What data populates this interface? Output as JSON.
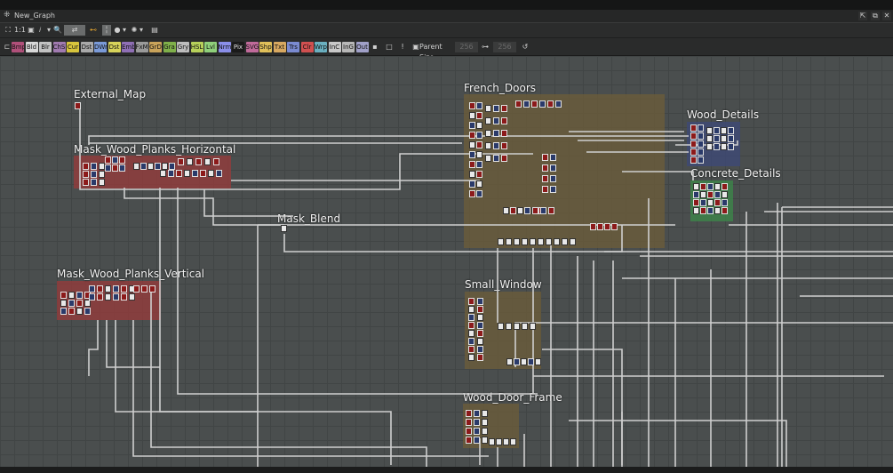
{
  "window": {
    "title": "New_Graph"
  },
  "toolbar": {
    "fit_label": "1:1",
    "buttons": [
      "fit-view-icon",
      "actual-size",
      "image-icon",
      "info-icon",
      "zoom-icon",
      "link-tool-icon",
      "snap-icon",
      "bulb-icon",
      "gear-icon",
      "screenshot-icon"
    ]
  },
  "filters": {
    "chips": [
      {
        "label": "Bmp",
        "color": "#b0507a"
      },
      {
        "label": "Bld",
        "color": "#d8d8d8"
      },
      {
        "label": "Blr",
        "color": "#c2c2c2"
      },
      {
        "label": "ChS",
        "color": "#a07ab0"
      },
      {
        "label": "Cur",
        "color": "#d7c43c"
      },
      {
        "label": "Dst",
        "color": "#a9a9a9"
      },
      {
        "label": "DWr",
        "color": "#7a9ad8"
      },
      {
        "label": "Dst",
        "color": "#d7d35a"
      },
      {
        "label": "Emb",
        "color": "#8f6fb5"
      },
      {
        "label": "FxM",
        "color": "#9a9a9a"
      },
      {
        "label": "GrD",
        "color": "#c9a35a"
      },
      {
        "label": "Gra",
        "color": "#7fb04a"
      },
      {
        "label": "Gry",
        "color": "#bdbdbd"
      },
      {
        "label": "HSL",
        "color": "#b7d05a"
      },
      {
        "label": "Lvl",
        "color": "#8fd07a"
      },
      {
        "label": "Nrm",
        "color": "#8a8ee8"
      },
      {
        "label": "Pix",
        "color": "#1a1a1a",
        "text": "#e0e0e0"
      },
      {
        "label": "SVG",
        "color": "#c06a9a"
      },
      {
        "label": "Shp",
        "color": "#e0c05a"
      },
      {
        "label": "Txt",
        "color": "#d8a860"
      },
      {
        "label": "Trs",
        "color": "#7a8ad0"
      },
      {
        "label": "Clr",
        "color": "#d05050"
      },
      {
        "label": "Wrp",
        "color": "#6ab0c0"
      },
      {
        "label": "InC",
        "color": "#c8c8c8"
      },
      {
        "label": "InG",
        "color": "#b8b8b8"
      },
      {
        "label": "Out",
        "color": "#a0a0c8"
      }
    ],
    "parent_size_label": "Parent Size:",
    "parent_size_value": "256",
    "parent_size_value2": "256"
  },
  "frames": [
    {
      "id": "external-map",
      "title": "External_Map",
      "color": null
    },
    {
      "id": "mask-wood-planks-horizontal",
      "title": "Mask_Wood_Planks_Horizontal",
      "color": "#9a3b3b"
    },
    {
      "id": "mask-blend",
      "title": "Mask_Blend",
      "color": null
    },
    {
      "id": "mask-wood-planks-vertical",
      "title": "Mask_Wood_Planks_Vertical",
      "color": "#9a3b3b"
    },
    {
      "id": "french-doors",
      "title": "French_Doors",
      "color": "#6e5d3a"
    },
    {
      "id": "wood-details",
      "title": "Wood_Details",
      "color": "#3e4a7a"
    },
    {
      "id": "concrete-details",
      "title": "Concrete_Details",
      "color": "#3c8a4a"
    },
    {
      "id": "small-window",
      "title": "Small_Window",
      "color": "#6e5d3a"
    },
    {
      "id": "wood-door-frame",
      "title": "Wood_Door_Frame",
      "color": "#6e5d3a"
    }
  ]
}
